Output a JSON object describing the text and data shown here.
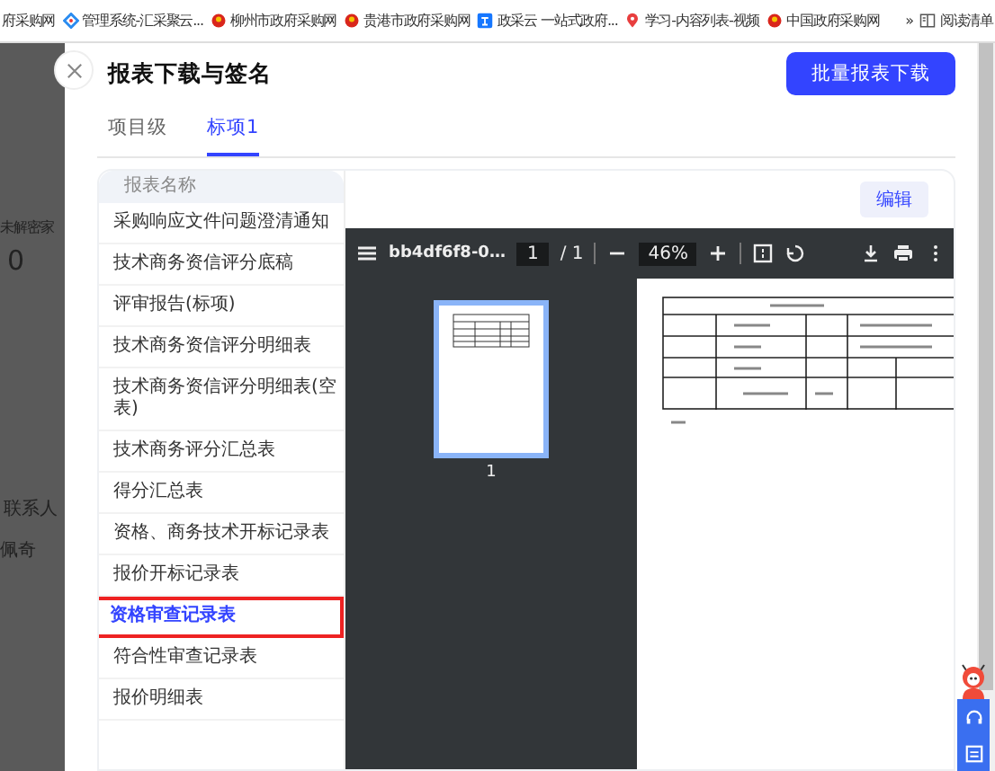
{
  "bookmarks": [
    {
      "label": "府采购网",
      "kind": "none"
    },
    {
      "label": "管理系统-汇采聚云...",
      "kind": "diamond"
    },
    {
      "label": "柳州市政府采购网",
      "kind": "emblem"
    },
    {
      "label": "贵港市政府采购网",
      "kind": "emblem"
    },
    {
      "label": "政采云 一站式政府...",
      "kind": "square"
    },
    {
      "label": "学习-内容列表-视频",
      "kind": "pin"
    },
    {
      "label": "中国政府采购网",
      "kind": "emblem"
    }
  ],
  "bookmarks_more": "»",
  "reading_list": "阅读清单",
  "background_page": {
    "label_1": "未解密家",
    "value_1": "0",
    "label_2": "联系人",
    "value_2": "佩奇"
  },
  "drawer": {
    "title": "报表下载与签名",
    "batch_button": "批量报表下载",
    "tabs": [
      {
        "label": "项目级",
        "selected": false
      },
      {
        "label": "标项1",
        "selected": true
      }
    ],
    "report_list": {
      "header": "报表名称",
      "items": [
        {
          "label": "采购响应文件问题澄清通知",
          "selected": false
        },
        {
          "label": "技术商务资信评分底稿",
          "selected": false
        },
        {
          "label": "评审报告(标项)",
          "selected": false
        },
        {
          "label": "技术商务资信评分明细表",
          "selected": false
        },
        {
          "label": "技术商务资信评分明细表(空表)",
          "selected": false
        },
        {
          "label": "技术商务评分汇总表",
          "selected": false
        },
        {
          "label": "得分汇总表",
          "selected": false
        },
        {
          "label": "资格、商务技术开标记录表",
          "selected": false
        },
        {
          "label": "报价开标记录表",
          "selected": false
        },
        {
          "label": "资格审查记录表",
          "selected": true
        },
        {
          "label": "符合性审查记录表",
          "selected": false
        },
        {
          "label": "报价明细表",
          "selected": false
        }
      ]
    },
    "edit_button": "编辑",
    "pdf_viewer": {
      "filename": "bb4df6f8-0…",
      "page": "1",
      "page_total": "/ 1",
      "zoom": "46%",
      "thumbnail_label": "1"
    }
  }
}
